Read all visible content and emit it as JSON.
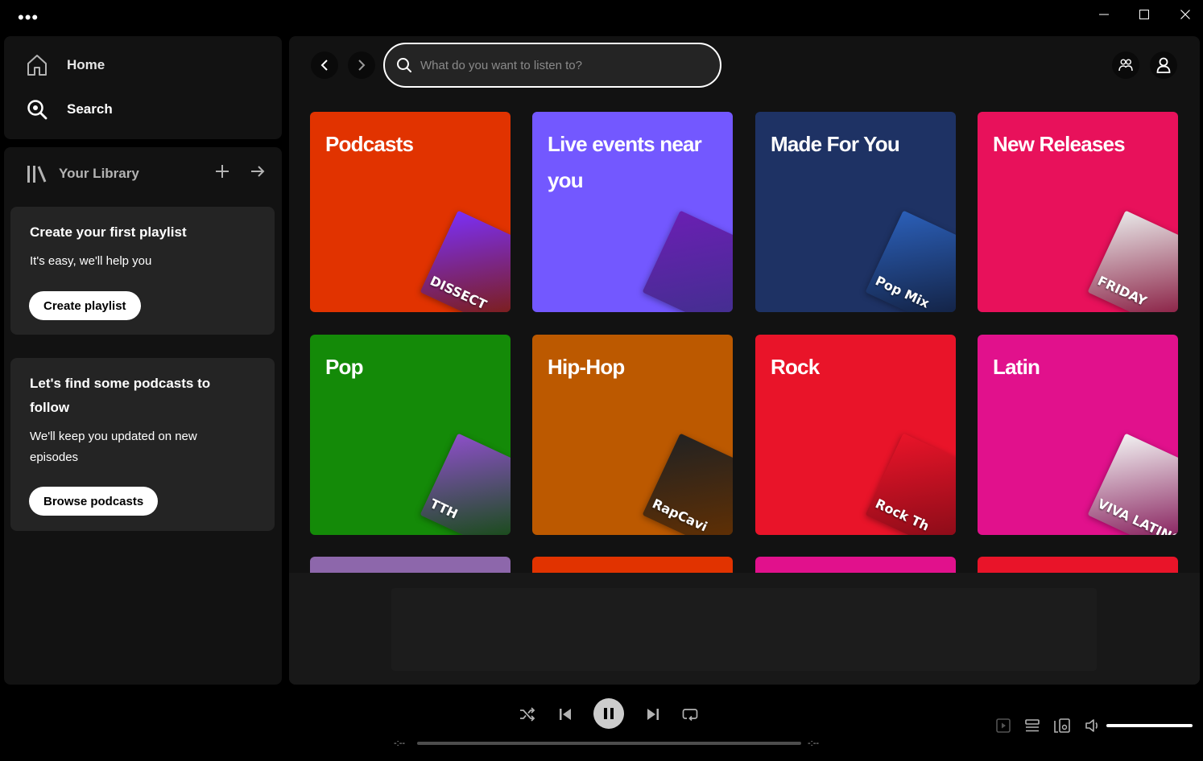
{
  "nav": {
    "home": "Home",
    "search": "Search"
  },
  "library": {
    "title": "Your Library",
    "playlist_card": {
      "title": "Create your first playlist",
      "subtitle": "It's easy, we'll help you",
      "button": "Create playlist"
    },
    "podcast_card": {
      "title_line1": "Let's find some podcasts to",
      "title_line2": "follow",
      "subtitle_line1": "We'll keep you updated on new",
      "subtitle_line2": "episodes",
      "button": "Browse podcasts"
    }
  },
  "search": {
    "placeholder": "What do you want to listen to?"
  },
  "tiles": [
    {
      "title": "Podcasts",
      "color": "#e13300",
      "art_label": "DISSECT",
      "art_color": "#7b2ff7"
    },
    {
      "title": "Live events near you",
      "color": "#7358ff",
      "art_label": "",
      "art_color": "#6a1fb3"
    },
    {
      "title": "Made For You",
      "color": "#1e3264",
      "art_label": "Pop Mix",
      "art_color": "#2b5fb8"
    },
    {
      "title": "New Releases",
      "color": "#e8115b",
      "art_label": "FRIDAY",
      "art_color": "#e8e8e8"
    },
    {
      "title": "Pop",
      "color": "#148a08",
      "art_label": "TTH",
      "art_color": "#8d4fc9"
    },
    {
      "title": "Hip-Hop",
      "color": "#bc5900",
      "art_label": "RapCavi",
      "art_color": "#222222"
    },
    {
      "title": "Rock",
      "color": "#e91429",
      "art_label": "Rock Th",
      "art_color": "#e91429"
    },
    {
      "title": "Latin",
      "color": "#e1118c",
      "art_label": "VIVA LATINO",
      "art_color": "#f2f2f2"
    }
  ],
  "stub_colors": [
    "#8d67ab",
    "#e13300",
    "#e1118c",
    "#e91429"
  ],
  "player": {
    "time_elapsed": "-:--",
    "time_total": "-:--",
    "progress": 0,
    "volume": 1.0
  },
  "colors": {
    "accent": "#1ed760",
    "background": "#121212",
    "card": "#242424"
  }
}
